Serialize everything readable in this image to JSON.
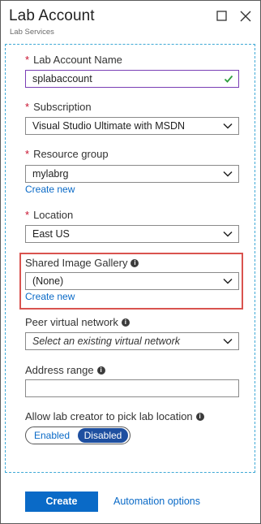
{
  "header": {
    "title": "Lab Account",
    "subtitle": "Lab Services"
  },
  "form": {
    "lab_account_name": {
      "label": "Lab Account Name",
      "value": "splabaccount"
    },
    "subscription": {
      "label": "Subscription",
      "value": "Visual Studio Ultimate with MSDN"
    },
    "resource_group": {
      "label": "Resource group",
      "value": "mylabrg",
      "link": "Create new"
    },
    "location": {
      "label": "Location",
      "value": "East US"
    },
    "shared_image_gallery": {
      "label": "Shared Image Gallery",
      "value": "(None)",
      "link": "Create new"
    },
    "peer_virtual_network": {
      "label": "Peer virtual network",
      "placeholder": "Select an existing virtual network"
    },
    "address_range": {
      "label": "Address range",
      "value": ""
    },
    "allow_pick_location": {
      "label": "Allow lab creator to pick lab location",
      "options": [
        "Enabled",
        "Disabled"
      ],
      "selected": "Disabled"
    }
  },
  "footer": {
    "create_label": "Create",
    "automation_label": "Automation options"
  },
  "colors": {
    "accent": "#0a6ac7",
    "required": "#c8102e",
    "highlight": "#d9534f",
    "toggle_selected": "#1e4fa0",
    "valid_check": "#2e9e3f"
  },
  "icons": {
    "maximize": "maximize-icon",
    "close": "close-icon",
    "chevron": "chevron-down-icon",
    "check": "check-icon",
    "info": "info-icon"
  }
}
